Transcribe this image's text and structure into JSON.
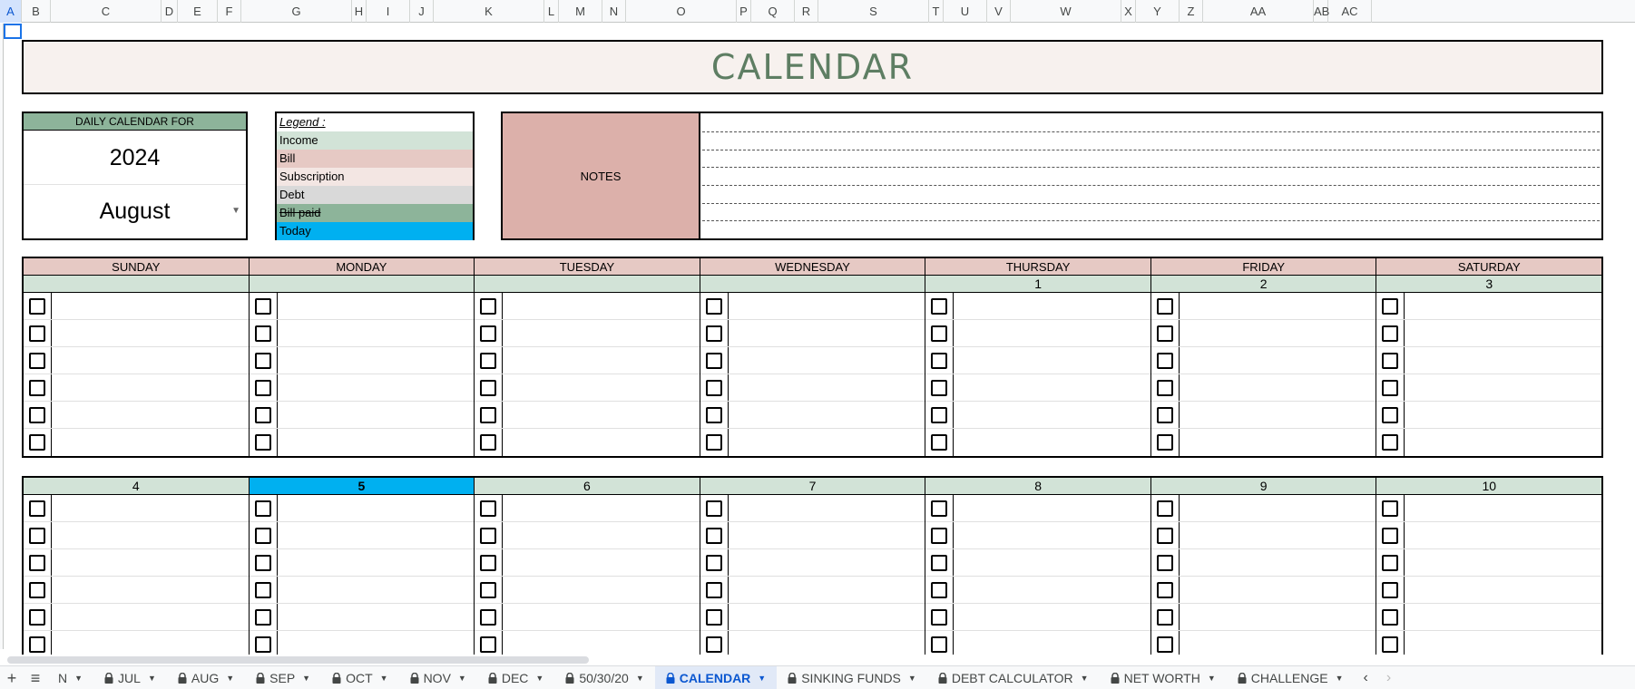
{
  "columns": [
    "A",
    "B",
    "C",
    "D",
    "E",
    "F",
    "G",
    "H",
    "I",
    "J",
    "K",
    "L",
    "M",
    "N",
    "O",
    "P",
    "Q",
    "R",
    "S",
    "T",
    "U",
    "V",
    "W",
    "X",
    "Y",
    "Z",
    "AA",
    "AB",
    "AC"
  ],
  "selected_column": "A",
  "title": "CALENDAR",
  "daily": {
    "header": "DAILY CALENDAR FOR",
    "year": "2024",
    "month": "August"
  },
  "legend": {
    "heading": "Legend :",
    "items": [
      {
        "label": "Income",
        "color": "#d2e3d7"
      },
      {
        "label": "Bill",
        "color": "#e6c9c4"
      },
      {
        "label": "Subscription",
        "color": "#f3e6e3"
      },
      {
        "label": "Debt",
        "color": "#d9d9d9"
      },
      {
        "label": "Bill paid",
        "color": "#8db49a"
      },
      {
        "label": "Today",
        "color": "#00b0f0"
      }
    ]
  },
  "notes": {
    "label": "NOTES"
  },
  "weekdays": [
    "SUNDAY",
    "MONDAY",
    "TUESDAY",
    "WEDNESDAY",
    "THURSDAY",
    "FRIDAY",
    "SATURDAY"
  ],
  "weeks": [
    {
      "dates": [
        "",
        "",
        "",
        "",
        "1",
        "2",
        "3"
      ]
    },
    {
      "dates": [
        "4",
        "5",
        "6",
        "7",
        "8",
        "9",
        "10"
      ]
    }
  ],
  "today": "5",
  "tabs": [
    {
      "label": "N",
      "locked": false,
      "active": false
    },
    {
      "label": "JUL",
      "locked": true,
      "active": false
    },
    {
      "label": "AUG",
      "locked": true,
      "active": false
    },
    {
      "label": "SEP",
      "locked": true,
      "active": false
    },
    {
      "label": "OCT",
      "locked": true,
      "active": false
    },
    {
      "label": "NOV",
      "locked": true,
      "active": false
    },
    {
      "label": "DEC",
      "locked": true,
      "active": false
    },
    {
      "label": "50/30/20",
      "locked": true,
      "active": false
    },
    {
      "label": "CALENDAR",
      "locked": true,
      "active": true
    },
    {
      "label": "SINKING FUNDS",
      "locked": true,
      "active": false
    },
    {
      "label": "DEBT CALCULATOR",
      "locked": true,
      "active": false
    },
    {
      "label": "NET WORTH",
      "locked": true,
      "active": false
    },
    {
      "label": "CHALLENGE",
      "locked": true,
      "active": false
    }
  ]
}
